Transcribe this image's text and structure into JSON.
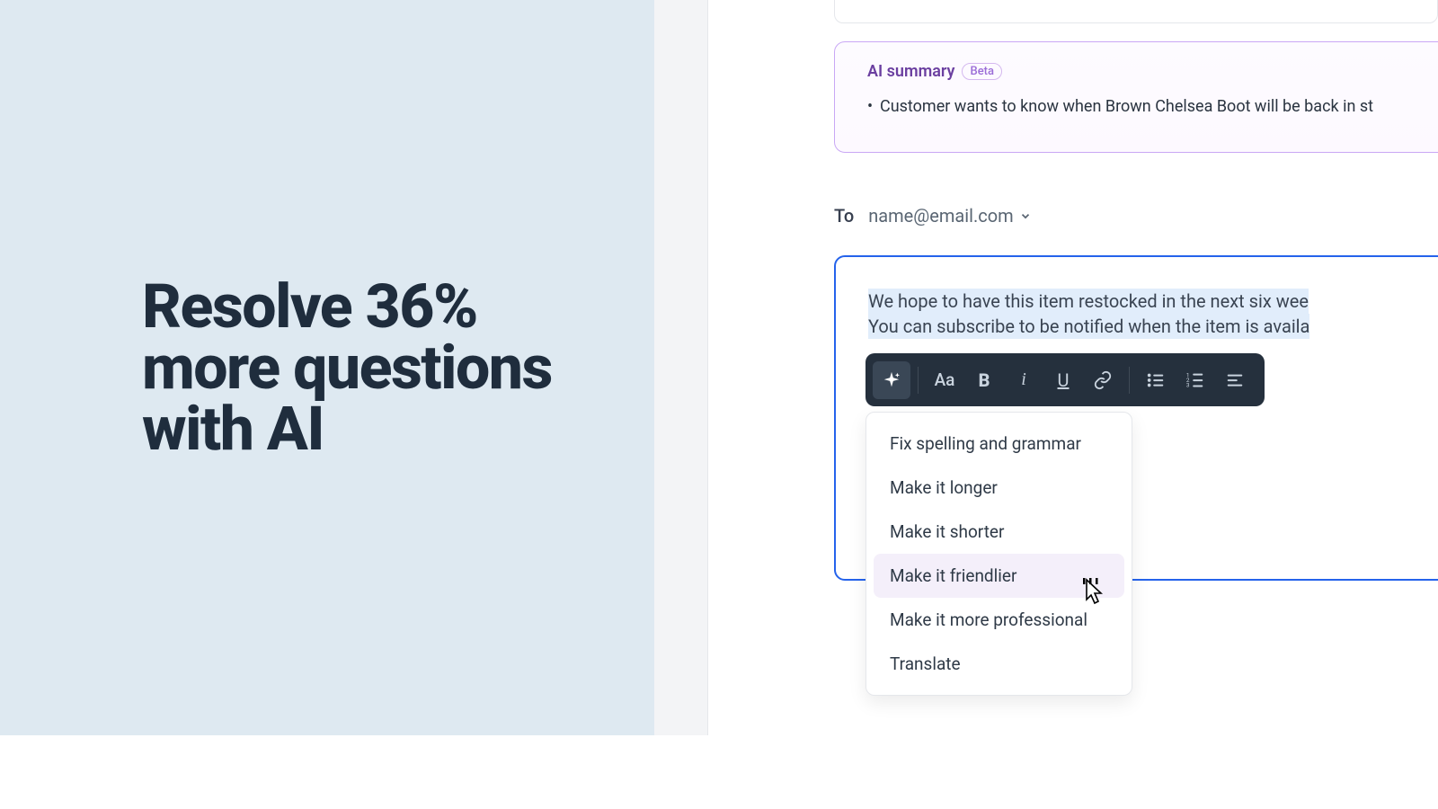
{
  "hero": {
    "headline_l1": "Resolve 36%",
    "headline_l2": "more questions",
    "headline_l3": "with AI"
  },
  "ai_summary": {
    "title": "AI summary",
    "badge": "Beta",
    "bullets": [
      "Customer wants to know when Brown Chelsea Boot will be back in st"
    ]
  },
  "compose": {
    "to_label": "To",
    "to_email": "name@email.com",
    "draft_line1": "We hope to have this item restocked in the next six wee",
    "draft_line2": "You can subscribe to be notified when the item is availa"
  },
  "toolbar": {
    "icons": {
      "sparkle": "ai-sparkle-icon",
      "textsize": "text-size-icon",
      "bold": "bold-icon",
      "italic": "italic-icon",
      "underline": "underline-icon",
      "link": "link-icon",
      "ulist": "bullet-list-icon",
      "olist": "numbered-list-icon",
      "align": "align-left-icon"
    }
  },
  "ai_menu": {
    "items": [
      "Fix spelling and grammar",
      "Make it longer",
      "Make it shorter",
      "Make it friendlier",
      "Make it more professional",
      "Translate"
    ],
    "hover_index": 3
  },
  "colors": {
    "left_bg": "#dee9f1",
    "accent_purple": "#6b3fa0",
    "compose_border": "#2563eb",
    "toolbar_bg": "#25303d"
  }
}
